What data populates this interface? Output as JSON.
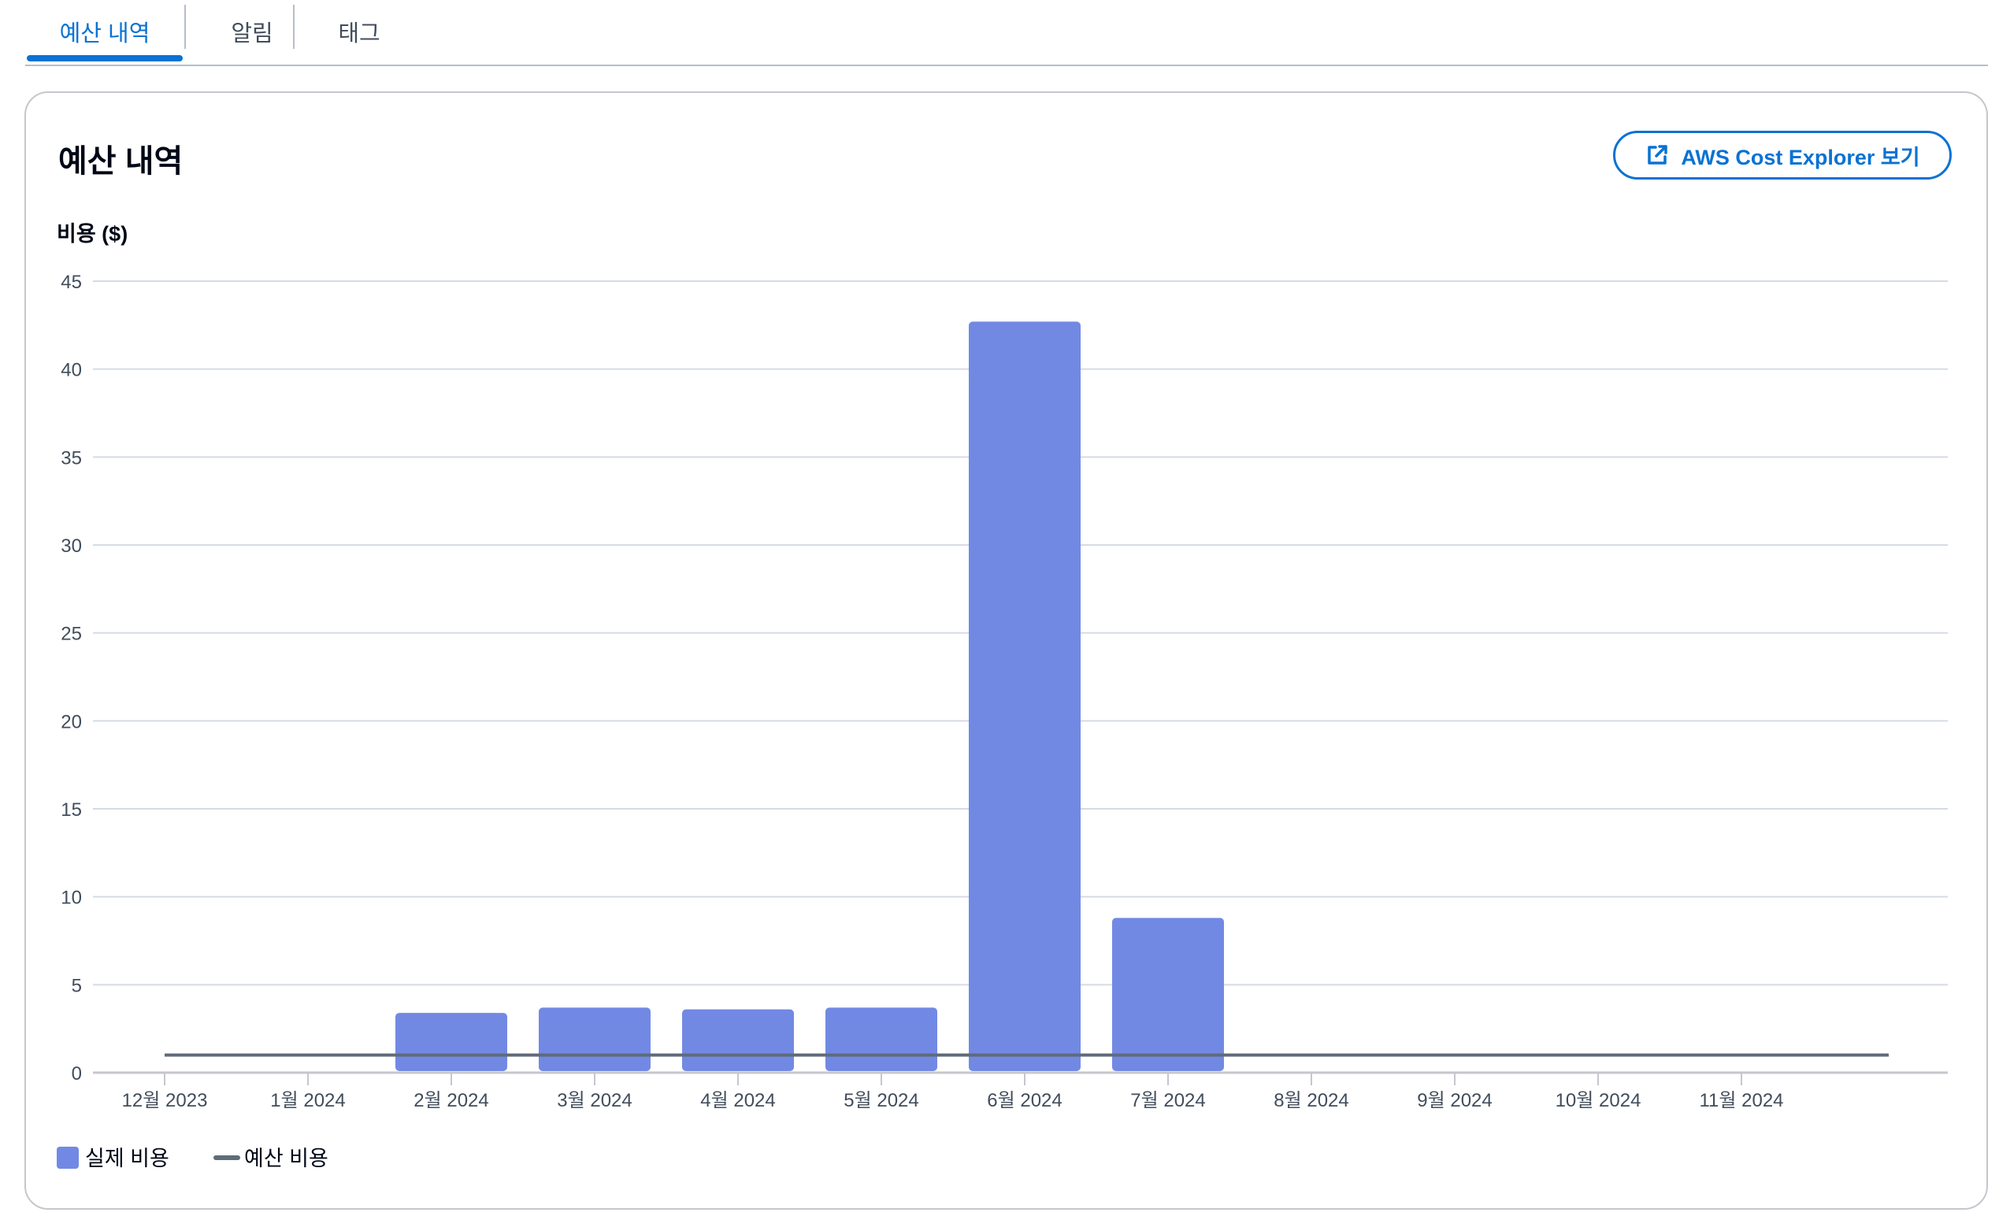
{
  "tabs": [
    {
      "label": "예산 내역",
      "active": true
    },
    {
      "label": "알림",
      "active": false
    },
    {
      "label": "태그",
      "active": false
    }
  ],
  "card": {
    "title": "예산 내역",
    "external_button": {
      "label": "AWS Cost Explorer 보기",
      "icon": "external-link-icon"
    }
  },
  "colors": {
    "accent": "#0972d3",
    "bar": "#7289e4",
    "budget_line": "#5f6b7a",
    "grid": "#d5dbe5"
  },
  "chart_data": {
    "type": "bar",
    "ylabel": "비용 ($)",
    "xlabel": "",
    "ylim": [
      0,
      45
    ],
    "yticks": [
      0,
      5,
      10,
      15,
      20,
      25,
      30,
      35,
      40,
      45
    ],
    "grid": true,
    "legend_position": "bottom-left",
    "categories": [
      "12월 2023",
      "1월 2024",
      "2월 2024",
      "3월 2024",
      "4월 2024",
      "5월 2024",
      "6월 2024",
      "7월 2024",
      "8월 2024",
      "9월 2024",
      "10월 2024",
      "11월 2024"
    ],
    "series": [
      {
        "name": "실제 비용",
        "type": "bar",
        "values": [
          null,
          null,
          3.4,
          3.7,
          3.6,
          3.7,
          42.7,
          8.8,
          null,
          null,
          null,
          null
        ]
      },
      {
        "name": "예산 비용",
        "type": "line",
        "values": [
          1,
          1,
          1,
          1,
          1,
          1,
          1,
          1,
          1,
          1,
          1,
          1
        ]
      }
    ]
  }
}
